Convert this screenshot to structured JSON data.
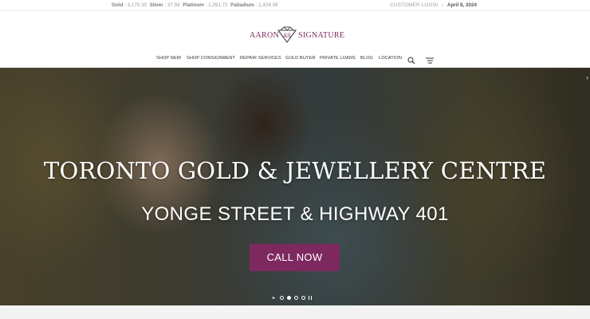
{
  "topbar": {
    "prices": [
      {
        "label": "Gold",
        "value": "3,175.30"
      },
      {
        "label": "Silver",
        "value": "37.56"
      },
      {
        "label": "Platinum",
        "value": "1,291.72"
      },
      {
        "label": "Palladium",
        "value": "1,424.08"
      }
    ],
    "customer_login": "CUSTOMER LOGIN",
    "date": "April 8, 2024"
  },
  "logo": {
    "word1": "AARON",
    "word2": "SIGNATURE",
    "brand_color": "#7a2b5c"
  },
  "nav": {
    "items": [
      {
        "label": "SHOP NEW"
      },
      {
        "label": "SHOP CONSIGNMENT"
      },
      {
        "label": "REPAIR SERVICES"
      },
      {
        "label": "GOLD BUYER"
      },
      {
        "label": "PRIVATE LOANS"
      },
      {
        "label": "BLOG"
      },
      {
        "label": "LOCATION"
      }
    ],
    "icons": [
      "search-icon",
      "cart-icon"
    ]
  },
  "hero": {
    "title": "TORONTO GOLD & JEWELLERY CENTRE",
    "subtitle": "YONGE STREET & HIGHWAY 401",
    "cta_label": "CALL NOW",
    "cta_color": "#7d2960",
    "slider": {
      "slide_count": 3,
      "active_slide": 2
    }
  }
}
